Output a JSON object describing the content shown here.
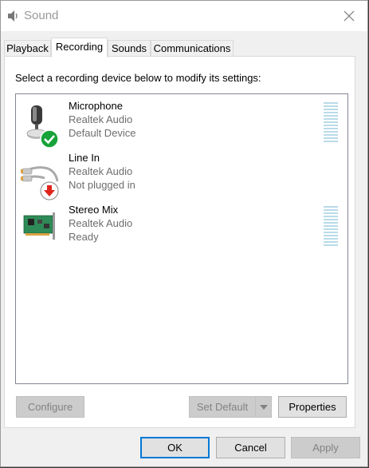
{
  "window": {
    "title": "Sound"
  },
  "tabs": [
    {
      "label": "Playback"
    },
    {
      "label": "Recording"
    },
    {
      "label": "Sounds"
    },
    {
      "label": "Communications"
    }
  ],
  "recording": {
    "instruction": "Select a recording device below to modify its settings:",
    "devices": [
      {
        "name": "Microphone",
        "driver": "Realtek Audio",
        "status": "Default Device",
        "icon": "microphone-icon",
        "status_badge": "default-check-icon"
      },
      {
        "name": "Line In",
        "driver": "Realtek Audio",
        "status": "Not plugged in",
        "icon": "line-in-jack-icon",
        "status_badge": "unplugged-arrow-icon"
      },
      {
        "name": "Stereo Mix",
        "driver": "Realtek Audio",
        "status": "Ready",
        "icon": "sound-card-icon"
      }
    ],
    "buttons": {
      "configure": "Configure",
      "set_default": "Set Default",
      "properties": "Properties"
    }
  },
  "dialog_buttons": {
    "ok": "OK",
    "cancel": "Cancel",
    "apply": "Apply"
  },
  "colors": {
    "meter": "#b9dbe9",
    "check_green": "#18a33a",
    "unplugged_red": "#e0241b"
  }
}
